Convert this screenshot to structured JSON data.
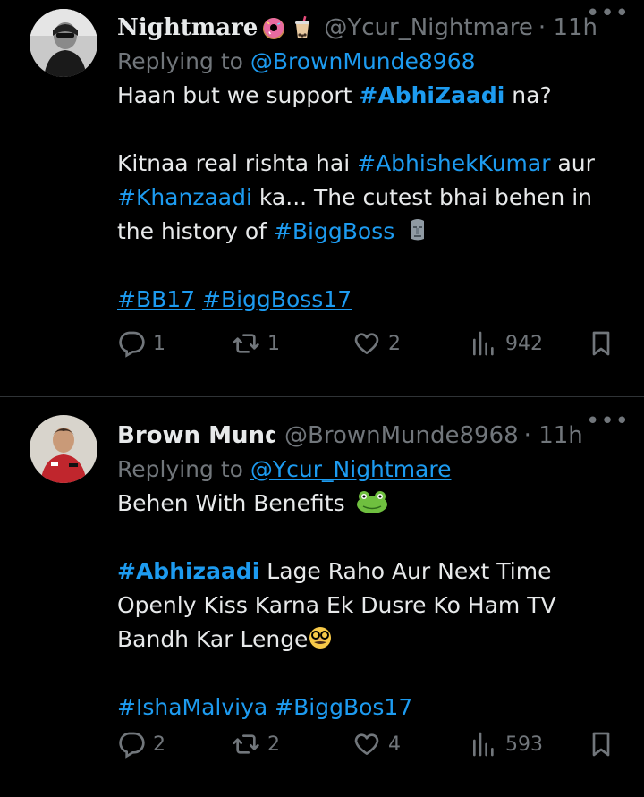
{
  "tweets": [
    {
      "name": "Nightmare",
      "handle": "@Ycur_Nightmare",
      "time": "· 11h",
      "replying_label": "Replying to",
      "replying_to": "@BrownMunde8968",
      "para1": [
        "Haan but we support ",
        "#AbhiZaadi",
        " na?"
      ],
      "para2": [
        "Kitnaa real rishta hai ",
        "#AbhishekKumar",
        " aur ",
        "#Khanzaadi",
        " ka... The cutest bhai behen in the history of ",
        "#BiggBoss"
      ],
      "para3": [
        "#BB17",
        "#BiggBoss17"
      ],
      "replies": "1",
      "retweets": "1",
      "likes": "2",
      "views": "942"
    },
    {
      "name": "Brown Munde",
      "handle": "@BrownMunde8968",
      "time": "· 11h",
      "replying_label": "Replying to",
      "replying_to": "@Ycur_Nightmare",
      "para1": [
        "Behen With Benefits "
      ],
      "para2": [
        "#Abhizaadi",
        " Lage Raho Aur Next Time Openly Kiss Karna Ek Dusre Ko Ham TV Bandh Kar Lenge"
      ],
      "para3": [
        "#IshaMalviya",
        "#BiggBos17"
      ],
      "replies": "2",
      "retweets": "2",
      "likes": "4",
      "views": "593"
    }
  ],
  "icons": {
    "reply": "reply-icon",
    "retweet": "retweet-icon",
    "like": "heart-icon",
    "views": "views-icon",
    "bookmark": "bookmark-icon",
    "more": "more-icon"
  },
  "colors": {
    "background": "#000000",
    "text": "#e7e9ea",
    "muted": "#71767b",
    "link": "#1d9bf0",
    "divider": "#2f3336"
  }
}
